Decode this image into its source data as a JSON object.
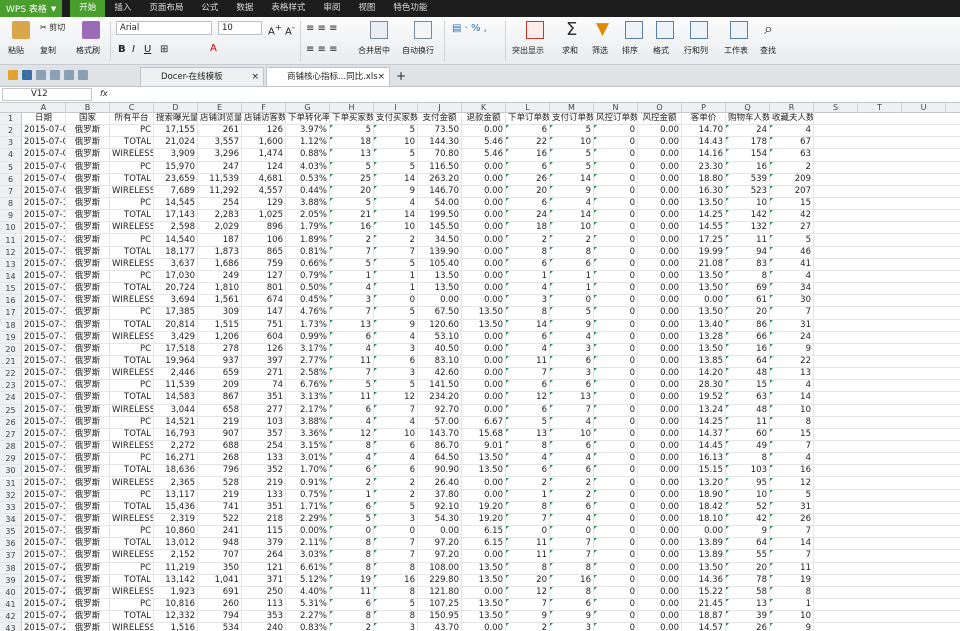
{
  "app": {
    "name": "WPS 表格",
    "menus": [
      "开始",
      "插入",
      "页面布局",
      "公式",
      "数据",
      "表格样式",
      "审阅",
      "视图",
      "特色功能"
    ],
    "active_menu": "开始"
  },
  "ribbon": {
    "paste": "粘贴",
    "cut": "剪切",
    "copy": "复制",
    "format_painter": "格式刷",
    "font": "Arial",
    "size": "10",
    "merge": "合并居中",
    "wrap": "自动换行",
    "cond": "突出显示",
    "sum": "求和",
    "filter": "筛选",
    "sort": "排序",
    "fmt": "格式",
    "rowcol": "行和列",
    "sheet": "工作表",
    "find": "查找"
  },
  "tabs": [
    "Docer-在线模板",
    "商铺核心指标...同比.xls"
  ],
  "formula": {
    "cell_ref": "V12",
    "fx": "fx"
  },
  "columns": [
    "A",
    "B",
    "C",
    "D",
    "E",
    "F",
    "G",
    "H",
    "I",
    "J",
    "K",
    "L",
    "M",
    "N",
    "O",
    "P",
    "Q",
    "R",
    "S",
    "T",
    "U"
  ],
  "headers": [
    "日期",
    "国家",
    "所有平台",
    "搜索曝光量",
    "店铺浏览量",
    "店铺访客数",
    "下单转化率",
    "下单买家数",
    "支付买家数",
    "支付金额",
    "退款金额",
    "下单订单数",
    "支付订单数",
    "风控订单数",
    "风控金额",
    "客单价",
    "购物车人数",
    "收藏夫人数"
  ],
  "rows": [
    [
      "2015-07-08",
      "俄罗斯",
      "PC",
      "17,155",
      "261",
      "126",
      "3.97%",
      "5",
      "5",
      "73.50",
      "0.00",
      "6",
      "5",
      "0",
      "0.00",
      "14.70",
      "24",
      "4"
    ],
    [
      "2015-07-08",
      "俄罗斯",
      "TOTAL",
      "21,024",
      "3,557",
      "1,600",
      "1.12%",
      "18",
      "10",
      "144.30",
      "5.46",
      "22",
      "10",
      "0",
      "0.00",
      "14.43",
      "178",
      "67"
    ],
    [
      "2015-07-08",
      "俄罗斯",
      "WIRELESS",
      "3,909",
      "3,296",
      "1,474",
      "0.88%",
      "13",
      "5",
      "70.80",
      "5.46",
      "16",
      "5",
      "0",
      "0.00",
      "14.16",
      "154",
      "63"
    ],
    [
      "2015-07-09",
      "俄罗斯",
      "PC",
      "15,970",
      "247",
      "124",
      "4.03%",
      "5",
      "5",
      "116.50",
      "0.00",
      "6",
      "5",
      "0",
      "0.00",
      "23.30",
      "16",
      "2"
    ],
    [
      "2015-07-09",
      "俄罗斯",
      "TOTAL",
      "23,659",
      "11,539",
      "4,681",
      "0.53%",
      "25",
      "14",
      "263.20",
      "0.00",
      "26",
      "14",
      "0",
      "0.00",
      "18.80",
      "539",
      "209"
    ],
    [
      "2015-07-09",
      "俄罗斯",
      "WIRELESS",
      "7,689",
      "11,292",
      "4,557",
      "0.44%",
      "20",
      "9",
      "146.70",
      "0.00",
      "20",
      "9",
      "0",
      "0.00",
      "16.30",
      "523",
      "207"
    ],
    [
      "2015-07-10",
      "俄罗斯",
      "PC",
      "14,545",
      "254",
      "129",
      "3.88%",
      "5",
      "4",
      "54.00",
      "0.00",
      "6",
      "4",
      "0",
      "0.00",
      "13.50",
      "10",
      "15"
    ],
    [
      "2015-07-10",
      "俄罗斯",
      "TOTAL",
      "17,143",
      "2,283",
      "1,025",
      "2.05%",
      "21",
      "14",
      "199.50",
      "0.00",
      "24",
      "14",
      "0",
      "0.00",
      "14.25",
      "142",
      "42"
    ],
    [
      "2015-07-10",
      "俄罗斯",
      "WIRELESS",
      "2,598",
      "2,029",
      "896",
      "1.79%",
      "16",
      "10",
      "145.50",
      "0.00",
      "18",
      "10",
      "0",
      "0.00",
      "14.55",
      "132",
      "27"
    ],
    [
      "2015-07-11",
      "俄罗斯",
      "PC",
      "14,540",
      "187",
      "106",
      "1.89%",
      "2",
      "2",
      "34.50",
      "0.00",
      "2",
      "2",
      "0",
      "0.00",
      "17.25",
      "11",
      "5"
    ],
    [
      "2015-07-11",
      "俄罗斯",
      "TOTAL",
      "18,177",
      "1,873",
      "865",
      "0.81%",
      "7",
      "7",
      "139.90",
      "0.00",
      "8",
      "8",
      "0",
      "0.00",
      "19.99",
      "94",
      "46"
    ],
    [
      "2015-07-11",
      "俄罗斯",
      "WIRELESS",
      "3,637",
      "1,686",
      "759",
      "0.66%",
      "5",
      "5",
      "105.40",
      "0.00",
      "6",
      "6",
      "0",
      "0.00",
      "21.08",
      "83",
      "41"
    ],
    [
      "2015-07-12",
      "俄罗斯",
      "PC",
      "17,030",
      "249",
      "127",
      "0.79%",
      "1",
      "1",
      "13.50",
      "0.00",
      "1",
      "1",
      "0",
      "0.00",
      "13.50",
      "8",
      "4"
    ],
    [
      "2015-07-12",
      "俄罗斯",
      "TOTAL",
      "20,724",
      "1,810",
      "801",
      "0.50%",
      "4",
      "1",
      "13.50",
      "0.00",
      "4",
      "1",
      "0",
      "0.00",
      "13.50",
      "69",
      "34"
    ],
    [
      "2015-07-12",
      "俄罗斯",
      "WIRELESS",
      "3,694",
      "1,561",
      "674",
      "0.45%",
      "3",
      "0",
      "0.00",
      "0.00",
      "3",
      "0",
      "0",
      "0.00",
      "0.00",
      "61",
      "30"
    ],
    [
      "2015-07-13",
      "俄罗斯",
      "PC",
      "17,385",
      "309",
      "147",
      "4.76%",
      "7",
      "5",
      "67.50",
      "13.50",
      "8",
      "5",
      "0",
      "0.00",
      "13.50",
      "20",
      "7"
    ],
    [
      "2015-07-13",
      "俄罗斯",
      "TOTAL",
      "20,814",
      "1,515",
      "751",
      "1.73%",
      "13",
      "9",
      "120.60",
      "13.50",
      "14",
      "9",
      "0",
      "0.00",
      "13.40",
      "86",
      "31"
    ],
    [
      "2015-07-13",
      "俄罗斯",
      "WIRELESS",
      "3,429",
      "1,206",
      "604",
      "0.99%",
      "6",
      "4",
      "53.10",
      "0.00",
      "6",
      "4",
      "0",
      "0.00",
      "13.28",
      "66",
      "24"
    ],
    [
      "2015-07-14",
      "俄罗斯",
      "PC",
      "17,518",
      "278",
      "126",
      "3.17%",
      "4",
      "3",
      "40.50",
      "0.00",
      "4",
      "3",
      "0",
      "0.00",
      "13.50",
      "16",
      "9"
    ],
    [
      "2015-07-14",
      "俄罗斯",
      "TOTAL",
      "19,964",
      "937",
      "397",
      "2.77%",
      "11",
      "6",
      "83.10",
      "0.00",
      "11",
      "6",
      "0",
      "0.00",
      "13.85",
      "64",
      "22"
    ],
    [
      "2015-07-14",
      "俄罗斯",
      "WIRELESS",
      "2,446",
      "659",
      "271",
      "2.58%",
      "7",
      "3",
      "42.60",
      "0.00",
      "7",
      "3",
      "0",
      "0.00",
      "14.20",
      "48",
      "13"
    ],
    [
      "2015-07-15",
      "俄罗斯",
      "PC",
      "11,539",
      "209",
      "74",
      "6.76%",
      "5",
      "5",
      "141.50",
      "0.00",
      "6",
      "6",
      "0",
      "0.00",
      "28.30",
      "15",
      "4"
    ],
    [
      "2015-07-15",
      "俄罗斯",
      "TOTAL",
      "14,583",
      "867",
      "351",
      "3.13%",
      "11",
      "12",
      "234.20",
      "0.00",
      "12",
      "13",
      "0",
      "0.00",
      "19.52",
      "63",
      "14"
    ],
    [
      "2015-07-15",
      "俄罗斯",
      "WIRELESS",
      "3,044",
      "658",
      "277",
      "2.17%",
      "6",
      "7",
      "92.70",
      "0.00",
      "6",
      "7",
      "0",
      "0.00",
      "13.24",
      "48",
      "10"
    ],
    [
      "2015-07-16",
      "俄罗斯",
      "PC",
      "14,521",
      "219",
      "103",
      "3.88%",
      "4",
      "4",
      "57.00",
      "6.67",
      "5",
      "4",
      "0",
      "0.00",
      "14.25",
      "11",
      "8"
    ],
    [
      "2015-07-16",
      "俄罗斯",
      "TOTAL",
      "16,793",
      "907",
      "357",
      "3.36%",
      "12",
      "10",
      "143.70",
      "15.68",
      "13",
      "10",
      "0",
      "0.00",
      "14.37",
      "60",
      "15"
    ],
    [
      "2015-07-16",
      "俄罗斯",
      "WIRELESS",
      "2,272",
      "688",
      "254",
      "3.15%",
      "8",
      "6",
      "86.70",
      "9.01",
      "8",
      "6",
      "0",
      "0.00",
      "14.45",
      "49",
      "7"
    ],
    [
      "2015-07-17",
      "俄罗斯",
      "PC",
      "16,271",
      "268",
      "133",
      "3.01%",
      "4",
      "4",
      "64.50",
      "13.50",
      "4",
      "4",
      "0",
      "0.00",
      "16.13",
      "8",
      "4"
    ],
    [
      "2015-07-17",
      "俄罗斯",
      "TOTAL",
      "18,636",
      "796",
      "352",
      "1.70%",
      "6",
      "6",
      "90.90",
      "13.50",
      "6",
      "6",
      "0",
      "0.00",
      "15.15",
      "103",
      "16"
    ],
    [
      "2015-07-17",
      "俄罗斯",
      "WIRELESS",
      "2,365",
      "528",
      "219",
      "0.91%",
      "2",
      "2",
      "26.40",
      "0.00",
      "2",
      "2",
      "0",
      "0.00",
      "13.20",
      "95",
      "12"
    ],
    [
      "2015-07-18",
      "俄罗斯",
      "PC",
      "13,117",
      "219",
      "133",
      "0.75%",
      "1",
      "2",
      "37.80",
      "0.00",
      "1",
      "2",
      "0",
      "0.00",
      "18.90",
      "10",
      "5"
    ],
    [
      "2015-07-18",
      "俄罗斯",
      "TOTAL",
      "15,436",
      "741",
      "351",
      "1.71%",
      "6",
      "5",
      "92.10",
      "19.20",
      "8",
      "6",
      "0",
      "0.00",
      "18.42",
      "52",
      "31"
    ],
    [
      "2015-07-18",
      "俄罗斯",
      "WIRELESS",
      "2,319",
      "522",
      "218",
      "2.29%",
      "5",
      "3",
      "54.30",
      "19.20",
      "7",
      "4",
      "0",
      "0.00",
      "18.10",
      "42",
      "26"
    ],
    [
      "2015-07-19",
      "俄罗斯",
      "PC",
      "10,860",
      "241",
      "115",
      "0.00%",
      "0",
      "0",
      "0.00",
      "6.15",
      "0",
      "0",
      "0",
      "0.00",
      "0.00",
      "9",
      "7"
    ],
    [
      "2015-07-19",
      "俄罗斯",
      "TOTAL",
      "13,012",
      "948",
      "379",
      "2.11%",
      "8",
      "7",
      "97.20",
      "6.15",
      "11",
      "7",
      "0",
      "0.00",
      "13.89",
      "64",
      "14"
    ],
    [
      "2015-07-19",
      "俄罗斯",
      "WIRELESS",
      "2,152",
      "707",
      "264",
      "3.03%",
      "8",
      "7",
      "97.20",
      "0.00",
      "11",
      "7",
      "0",
      "0.00",
      "13.89",
      "55",
      "7"
    ],
    [
      "2015-07-20",
      "俄罗斯",
      "PC",
      "11,219",
      "350",
      "121",
      "6.61%",
      "8",
      "8",
      "108.00",
      "13.50",
      "8",
      "8",
      "0",
      "0.00",
      "13.50",
      "20",
      "11"
    ],
    [
      "2015-07-20",
      "俄罗斯",
      "TOTAL",
      "13,142",
      "1,041",
      "371",
      "5.12%",
      "19",
      "16",
      "229.80",
      "13.50",
      "20",
      "16",
      "0",
      "0.00",
      "14.36",
      "78",
      "19"
    ],
    [
      "2015-07-20",
      "俄罗斯",
      "WIRELESS",
      "1,923",
      "691",
      "250",
      "4.40%",
      "11",
      "8",
      "121.80",
      "0.00",
      "12",
      "8",
      "0",
      "0.00",
      "15.22",
      "58",
      "8"
    ],
    [
      "2015-07-21",
      "俄罗斯",
      "PC",
      "10,816",
      "260",
      "113",
      "5.31%",
      "6",
      "5",
      "107.25",
      "13.50",
      "7",
      "6",
      "0",
      "0.00",
      "21.45",
      "13",
      "1"
    ],
    [
      "2015-07-21",
      "俄罗斯",
      "TOTAL",
      "12,332",
      "794",
      "353",
      "2.27%",
      "8",
      "8",
      "150.95",
      "13.50",
      "9",
      "9",
      "0",
      "0.00",
      "18.87",
      "39",
      "10"
    ],
    [
      "2015-07-21",
      "俄罗斯",
      "WIRELESS",
      "1,516",
      "534",
      "240",
      "0.83%",
      "2",
      "3",
      "43.70",
      "0.00",
      "2",
      "3",
      "0",
      "0.00",
      "14.57",
      "26",
      "9"
    ]
  ]
}
